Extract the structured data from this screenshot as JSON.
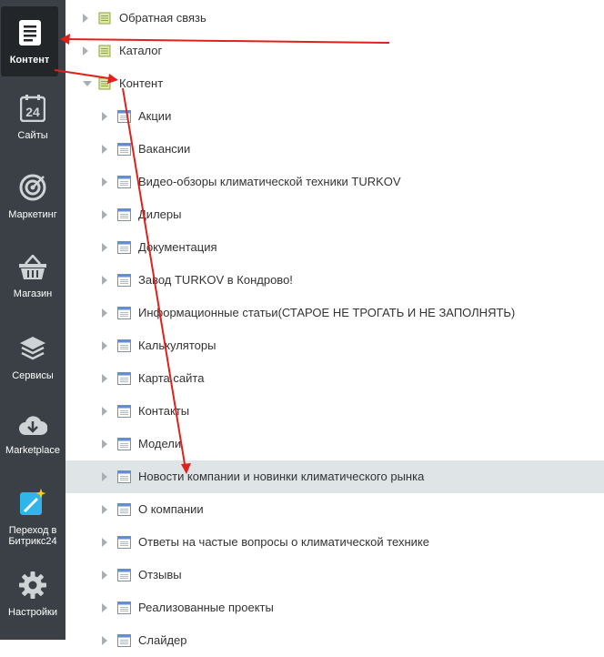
{
  "sidebar": {
    "items": [
      {
        "label": "Контент",
        "icon": "document-icon"
      },
      {
        "label": "Сайты",
        "icon": "calendar-24-icon"
      },
      {
        "label": "Маркетинг",
        "icon": "target-icon"
      },
      {
        "label": "Магазин",
        "icon": "basket-icon"
      },
      {
        "label": "Сервисы",
        "icon": "layers-icon"
      },
      {
        "label": "Marketplace",
        "icon": "cloud-download-icon"
      },
      {
        "label": "Переход в\nБитрикс24",
        "icon": "magic-wand-icon"
      },
      {
        "label": "Настройки",
        "icon": "gear-icon"
      }
    ]
  },
  "tree": {
    "top_nodes": [
      {
        "label": "Обратная связь"
      },
      {
        "label": "Каталог"
      },
      {
        "label": "Контент"
      }
    ],
    "children": [
      {
        "label": "Акции"
      },
      {
        "label": "Вакансии"
      },
      {
        "label": "Видео-обзоры климатической техники TURKOV"
      },
      {
        "label": "Дилеры"
      },
      {
        "label": "Документация"
      },
      {
        "label": "Завод TURKOV в Кондрово!"
      },
      {
        "label": "Информационные статьи(СТАРОЕ НЕ ТРОГАТЬ И НЕ ЗАПОЛНЯТЬ)"
      },
      {
        "label": "Калькуляторы"
      },
      {
        "label": "Карта сайта"
      },
      {
        "label": "Контакты"
      },
      {
        "label": "Модели"
      },
      {
        "label": "Новости компании и новинки климатического рынка"
      },
      {
        "label": "О компании"
      },
      {
        "label": "Ответы на частые вопросы о климатической технике"
      },
      {
        "label": "Отзывы"
      },
      {
        "label": "Реализованные проекты"
      },
      {
        "label": "Слайдер"
      }
    ],
    "selected_child_index": 11
  },
  "annotation_color": "#e0201b"
}
